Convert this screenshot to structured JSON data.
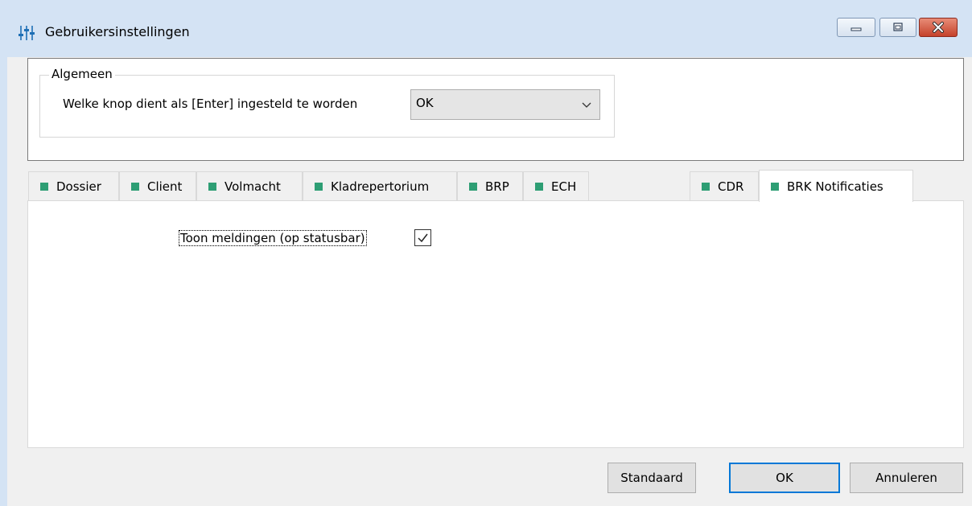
{
  "window": {
    "title": "Gebruikersinstellingen",
    "icon": "settings-sliders-icon",
    "controls": [
      "minimize-icon",
      "maximize-icon",
      "close-icon"
    ]
  },
  "general": {
    "group_label": "Algemeen",
    "enter_label": "Welke knop dient als [Enter] ingesteld te worden",
    "enter_value": "OK"
  },
  "tabs": [
    {
      "label": "Dossier",
      "active": false
    },
    {
      "label": "Client",
      "active": false
    },
    {
      "label": "Volmacht",
      "active": false
    },
    {
      "label": "Kladrepertorium",
      "active": false
    },
    {
      "label": "BRP",
      "active": false
    },
    {
      "label": "ECH",
      "active": false
    },
    {
      "label": "CDR",
      "active": false
    },
    {
      "label": "BRK Notificaties",
      "active": true
    }
  ],
  "notifications": {
    "show_label": "Toon meldingen (op statusbar)",
    "show_checked": true
  },
  "buttons": {
    "standard": "Standaard",
    "ok": "OK",
    "cancel": "Annuleren"
  },
  "colors": {
    "tab_indicator": "#2e9e74",
    "titlebar": "#d4e3f4",
    "close_button": "#c5422b",
    "default_button_border": "#0078d7"
  }
}
